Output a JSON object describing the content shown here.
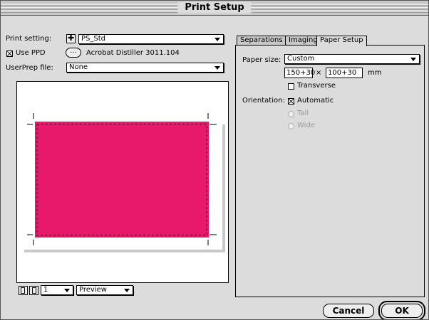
{
  "window": {
    "title": "Print Setup"
  },
  "left": {
    "print_setting_label": "Print setting:",
    "print_setting_value": "PS_Std",
    "use_ppd_label": "Use PPD",
    "use_ppd_checked": true,
    "ppd_button_label": "...",
    "ppd_name": "Acrobat Distiller 3011.104",
    "userprep_label": "UserPrep file:",
    "userprep_value": "None",
    "page_number": "1",
    "view_mode": "Preview"
  },
  "tabs": [
    {
      "label": "Separations",
      "active": false
    },
    {
      "label": "Imaging",
      "active": false
    },
    {
      "label": "Paper Setup",
      "active": true
    }
  ],
  "paper_setup": {
    "paper_size_label": "Paper size:",
    "paper_size_value": "Custom",
    "width": "150+30",
    "times": "×",
    "height": "100+30",
    "unit": "mm",
    "transverse_label": "Transverse",
    "transverse_checked": false,
    "orientation_label": "Orientation:",
    "automatic_label": "Automatic",
    "automatic_checked": true,
    "tall_label": "Tall",
    "wide_label": "Wide"
  },
  "buttons": {
    "cancel": "Cancel",
    "ok": "OK"
  },
  "colors": {
    "page_fill": "#e8186a",
    "dialog_bg": "#dcdcdc"
  }
}
